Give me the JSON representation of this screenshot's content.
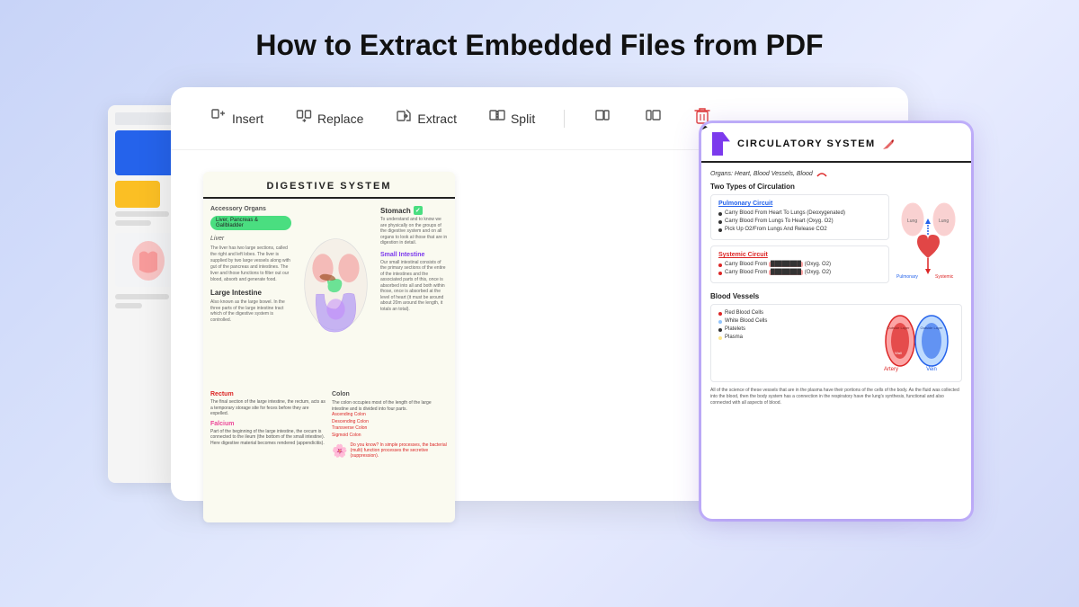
{
  "page": {
    "title": "How to Extract Embedded Files from PDF",
    "bg_gradient_start": "#c8d4f8",
    "bg_gradient_end": "#d0d8f8"
  },
  "toolbar": {
    "items": [
      {
        "id": "insert",
        "label": "Insert",
        "icon": "⊞"
      },
      {
        "id": "replace",
        "label": "Replace",
        "icon": "⟳"
      },
      {
        "id": "extract",
        "label": "Extract",
        "icon": "⬆"
      },
      {
        "id": "split",
        "label": "Split",
        "icon": "⧄"
      },
      {
        "id": "icon1",
        "label": "",
        "icon": "▭"
      },
      {
        "id": "icon2",
        "label": "",
        "icon": "▯"
      },
      {
        "id": "delete",
        "label": "",
        "icon": "🗑",
        "type": "delete"
      }
    ]
  },
  "digestive_page": {
    "title": "DIGESTIVE SYSTEM",
    "accessory_organs_label": "Accessory Organs",
    "accessory_list": "Liver, Pancreas & Gallbladder",
    "liver_label": "Liver",
    "stomach_label": "Stomach",
    "small_intestine_label": "Small Intestine",
    "large_intestine_label": "Large Intestine",
    "rectum_label": "Rectum",
    "falcium_label": "Falcium",
    "colon_label": "Colon"
  },
  "circulatory_page": {
    "title": "CIRCULATORY SYSTEM",
    "organs_row": "Organs: Heart, Blood Vessels, Blood",
    "two_types_title": "Two Types of Circulation",
    "pulmonary_title": "Pulmonary Circuit",
    "pulmonary_items": [
      "Carry Blood From Heart To Lungs (Deoxygenated)",
      "Carry Blood From Lungs To Heart (Oxyg. O2)",
      "Pick Up O2/From Lungs And Release CO2"
    ],
    "systemic_title": "Systemic Circuit",
    "systemic_items": [
      "Carry Blood From ████████ (Oxyg. O2)",
      "Carry Blood From ████████ (Oxyg. O2)"
    ],
    "blood_vessels_title": "Blood Vessels",
    "bv_items": [
      "Red Blood Cells",
      "White Blood Cells",
      "Platelets",
      "Plasma"
    ],
    "artery_label": "Artery",
    "vein_label": "Vein"
  }
}
